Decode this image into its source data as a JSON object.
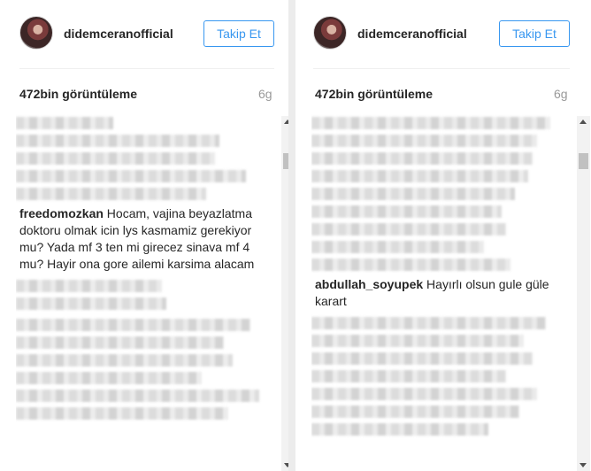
{
  "left": {
    "username": "didemceranofficial",
    "follow_label": "Takip Et",
    "views": "472bin görüntüleme",
    "age": "6g",
    "comment": {
      "user": "freedomozkan",
      "text": " Hocam, vajina beyazlatma doktoru olmak icin lys kasmamiz gerekiyor mu? Yada mf 3 ten mi girecez sinava mf 4 mu? Hayir ona gore ailemi karsima alacam"
    }
  },
  "right": {
    "username": "didemceranofficial",
    "follow_label": "Takip Et",
    "views": "472bin görüntüleme",
    "age": "6g",
    "comment": {
      "user": "abdullah_soyupek",
      "text": " Hayırlı olsun gule güle karart"
    }
  },
  "colors": {
    "accent": "#3897f0",
    "text": "#262626",
    "muted": "#999999"
  },
  "icons": [
    "avatar",
    "scroll-up-arrow-icon",
    "scroll-down-arrow-icon"
  ]
}
